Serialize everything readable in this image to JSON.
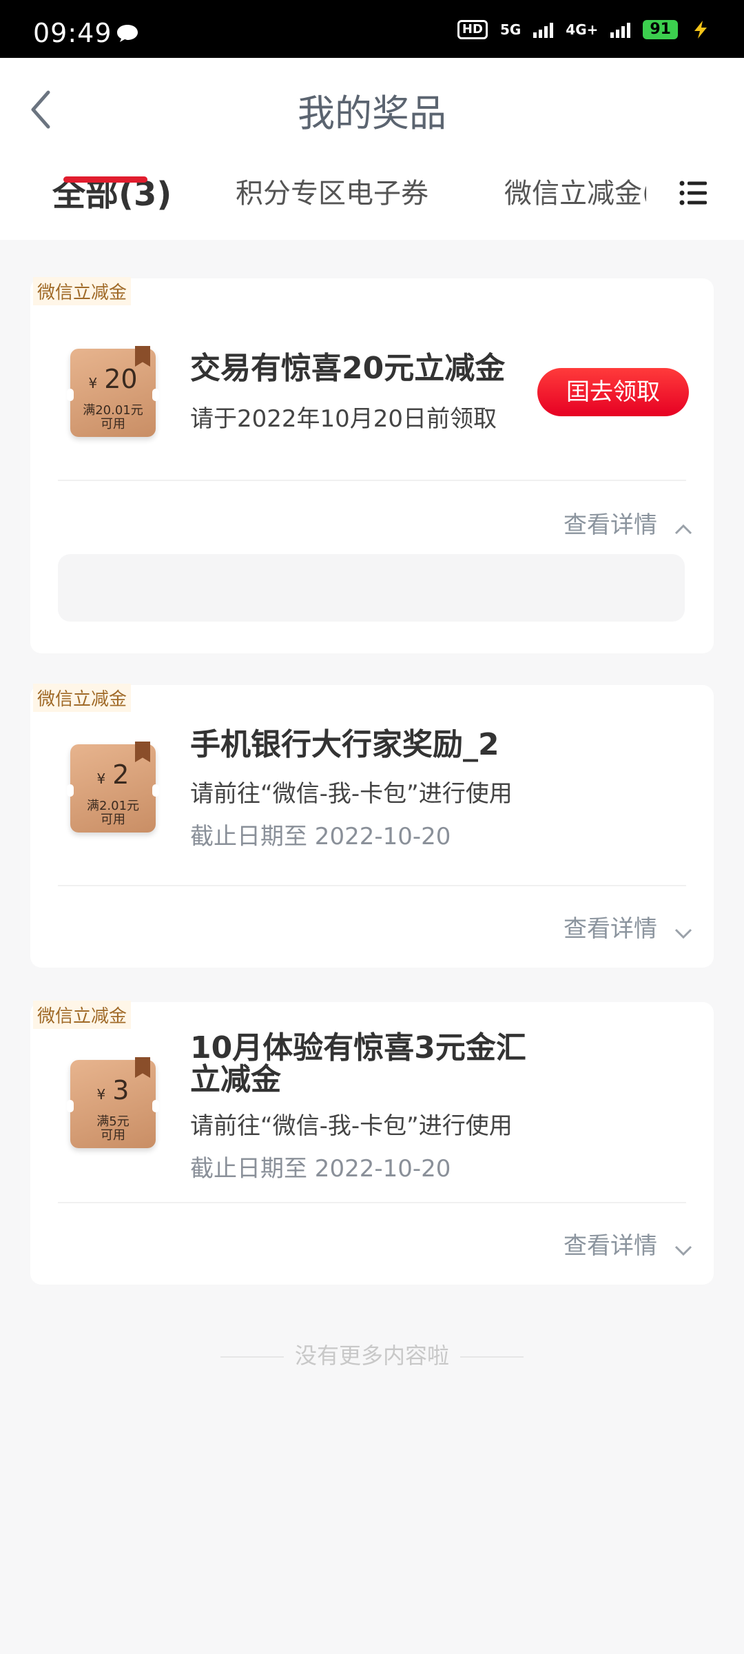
{
  "status_bar": {
    "time": "09:49",
    "hd_label": "HD",
    "net1": "5G",
    "net2": "4G+",
    "battery": "91",
    "battery_color": "#3ccf4e"
  },
  "header": {
    "title": "我的奖品",
    "tabs": [
      "全部(3)",
      "积分专区电子券",
      "微信立减金("
    ],
    "active_tab": 0,
    "accent_color": "#e11d2e"
  },
  "cards": [
    {
      "tag": "微信立减金",
      "coupon": {
        "currency": "¥",
        "amount": "20",
        "condition_line1": "满20.01元",
        "condition_line2": "可用"
      },
      "title": "交易有惊喜20元立减金",
      "line1": "请于2022年10月20日前领取",
      "button": "囯去领取",
      "detail": "查看详情",
      "expanded": true
    },
    {
      "tag": "微信立减金",
      "coupon": {
        "currency": "¥",
        "amount": "2",
        "condition_line1": "满2.01元",
        "condition_line2": "可用"
      },
      "title": "手机银行大行家奖励_2",
      "line1": "请前往“微信-我-卡包”进行使用",
      "line2": "截止日期至 2022-10-20",
      "detail": "查看详情",
      "expanded": false
    },
    {
      "tag": "微信立减金",
      "coupon": {
        "currency": "¥",
        "amount": "3",
        "condition_line1": "满5元",
        "condition_line2": "可用"
      },
      "title_line1": "10月体验有惊喜3元金汇",
      "title_line2": "立减金",
      "line1": "请前往“微信-我-卡包”进行使用",
      "line2": "截止日期至 2022-10-20",
      "detail": "查看详情",
      "expanded": false
    }
  ],
  "footer": {
    "no_more": "没有更多内容啦"
  }
}
